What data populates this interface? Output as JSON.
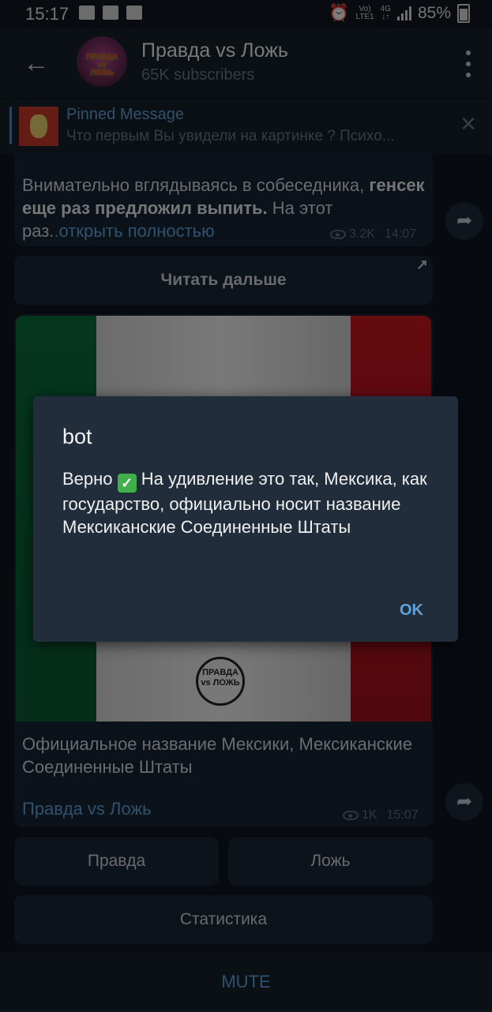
{
  "status_bar": {
    "time": "15:17",
    "network_top": "Vo)",
    "network_bottom": "LTE1",
    "net_type": "4G",
    "battery": "85%"
  },
  "header": {
    "title": "Правда vs Ложь",
    "subscribers": "65K subscribers",
    "back_icon": "arrow-left-icon",
    "menu_icon": "more-vertical-icon"
  },
  "pinned": {
    "title": "Pinned Message",
    "text": "Что первым Вы увидели на картинке ?  Психо..."
  },
  "message1": {
    "text_plain_start": "Внимательно вглядываясь в собеседника, ",
    "text_bold": "генсек еще раз предложил выпить.",
    "text_plain_end": " На этот раз.",
    "link": ".открыть полностью",
    "views": "3.2K",
    "time": "14:07"
  },
  "read_more_button": "Читать дальше",
  "message2": {
    "seal_text": "ПРАВДА vs ЛОЖЬ",
    "caption": "Официальное название Мексики, Мексиканские Соединенные Штаты",
    "signature": "Правда vs Ложь",
    "views": "1K",
    "time": "15:07"
  },
  "keyboard": {
    "truth": "Правда",
    "lie": "Ложь",
    "stats": "Статистика"
  },
  "bottom": {
    "mute": "MUTE"
  },
  "dialog": {
    "title": "bot",
    "text_before": "Верно ",
    "check": "✓",
    "text_after": " На удивление это так, Мексика, как государство, официально носит название Мексиканские Соединенные Штаты",
    "ok": "OK"
  },
  "colors": {
    "background": "#0e1621",
    "header": "#17212b",
    "accent": "#5ea3dd",
    "dialog": "#212d3b"
  }
}
